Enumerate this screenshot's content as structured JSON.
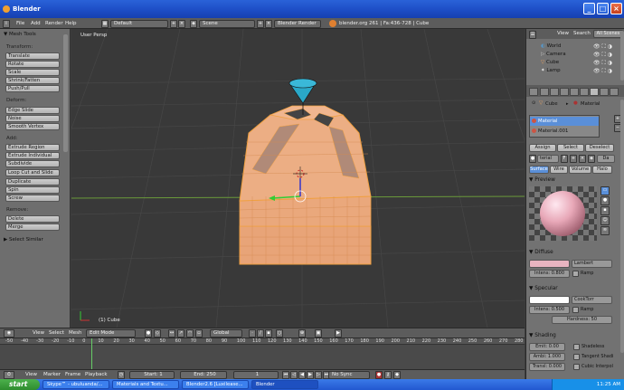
{
  "window": {
    "title": "Blender",
    "min": "_",
    "max": "□",
    "close": "×"
  },
  "infobar": {
    "menus": [
      "File",
      "Add",
      "Render",
      "Help"
    ],
    "layout": "Default",
    "scene": "Scene",
    "engine": "Blender Render",
    "stats": "blender.org 261 | Fa:436-728 | Cube"
  },
  "toolshelf": {
    "header": "▼ Mesh Tools",
    "sections": [
      {
        "title": "Transform:",
        "buttons": [
          "Translate",
          "Rotate",
          "Scale",
          "Shrink/Fatten",
          "Push/Pull"
        ]
      },
      {
        "title": "Deform:",
        "buttons": [
          "Edge Slide",
          "Noise",
          "Smooth Vertex"
        ]
      },
      {
        "title": "Add:",
        "buttons": [
          "Extrude Region",
          "Extrude Individual",
          "Subdivide",
          "Loop Cut and Slide",
          "Duplicate",
          "Spin",
          "Screw"
        ]
      },
      {
        "title": "Remove:",
        "buttons": [
          "Delete",
          "Merge"
        ]
      }
    ],
    "select_similar": "▶ Select Similar"
  },
  "viewport": {
    "label": "User Persp",
    "object_label": "(1) Cube"
  },
  "vpheader": {
    "menus": [
      "View",
      "Select",
      "Mesh"
    ],
    "mode": "Edit Mode",
    "orientation": "Global"
  },
  "timeline": {
    "ticks": [
      "-50",
      "-40",
      "-30",
      "-20",
      "-10",
      "0",
      "10",
      "20",
      "30",
      "40",
      "50",
      "60",
      "70",
      "80",
      "90",
      "100",
      "110",
      "120",
      "130",
      "140",
      "150",
      "160",
      "170",
      "180",
      "190",
      "200",
      "210",
      "220",
      "230",
      "240",
      "250",
      "260",
      "270",
      "280"
    ],
    "menus": [
      "View",
      "Marker",
      "Frame",
      "Playback"
    ],
    "start": "Start: 1",
    "end": "End: 250",
    "current": "1",
    "sync": "No Sync"
  },
  "outliner": {
    "header_view": "View",
    "header_search": "Search",
    "header_scenes": "All Scenes",
    "items": [
      {
        "name": "World"
      },
      {
        "name": "Camera"
      },
      {
        "name": "Cube"
      },
      {
        "name": "Lamp"
      }
    ]
  },
  "properties": {
    "breadcrumb_cube": "Cube",
    "breadcrumb_material": "Material",
    "slots": [
      "Material",
      "Material.001"
    ],
    "assign": "Assign",
    "select": "Select",
    "deselect": "Deselect",
    "mat_name": "terial",
    "mat_users": "Da",
    "tabs": [
      "Surface",
      "Wire",
      "Volume",
      "Halo"
    ],
    "preview": "▼ Preview",
    "diffuse": "▼ Diffuse",
    "diffuse_shader": "Lambert",
    "diffuse_intensity": "Intens: 0.800",
    "ramp": "Ramp",
    "specular": "▼ Specular",
    "spec_shader": "CookTorr",
    "spec_intensity": "Intens: 0.500",
    "hardness": "Hardness: 50",
    "shading": "▼ Shading",
    "emit": "Emit: 0.00",
    "ambi": "Ambi: 1.000",
    "transl": "Transl: 0.000",
    "shadeless": "Shadeless",
    "tangent": "Tangent Shadi",
    "cubic": "Cubic Interpol",
    "colors": {
      "diffuse": "#e8b4c0",
      "specular": "#ffffff",
      "selected_slot": "#5a8fd8"
    }
  },
  "taskbar": {
    "start": "start",
    "tasks": [
      "Skype™ - ubuluanda/...",
      "Materials and Textu...",
      "Blender2.6 [Luxilease...",
      "Blender"
    ],
    "clock": "11:25 AM"
  }
}
